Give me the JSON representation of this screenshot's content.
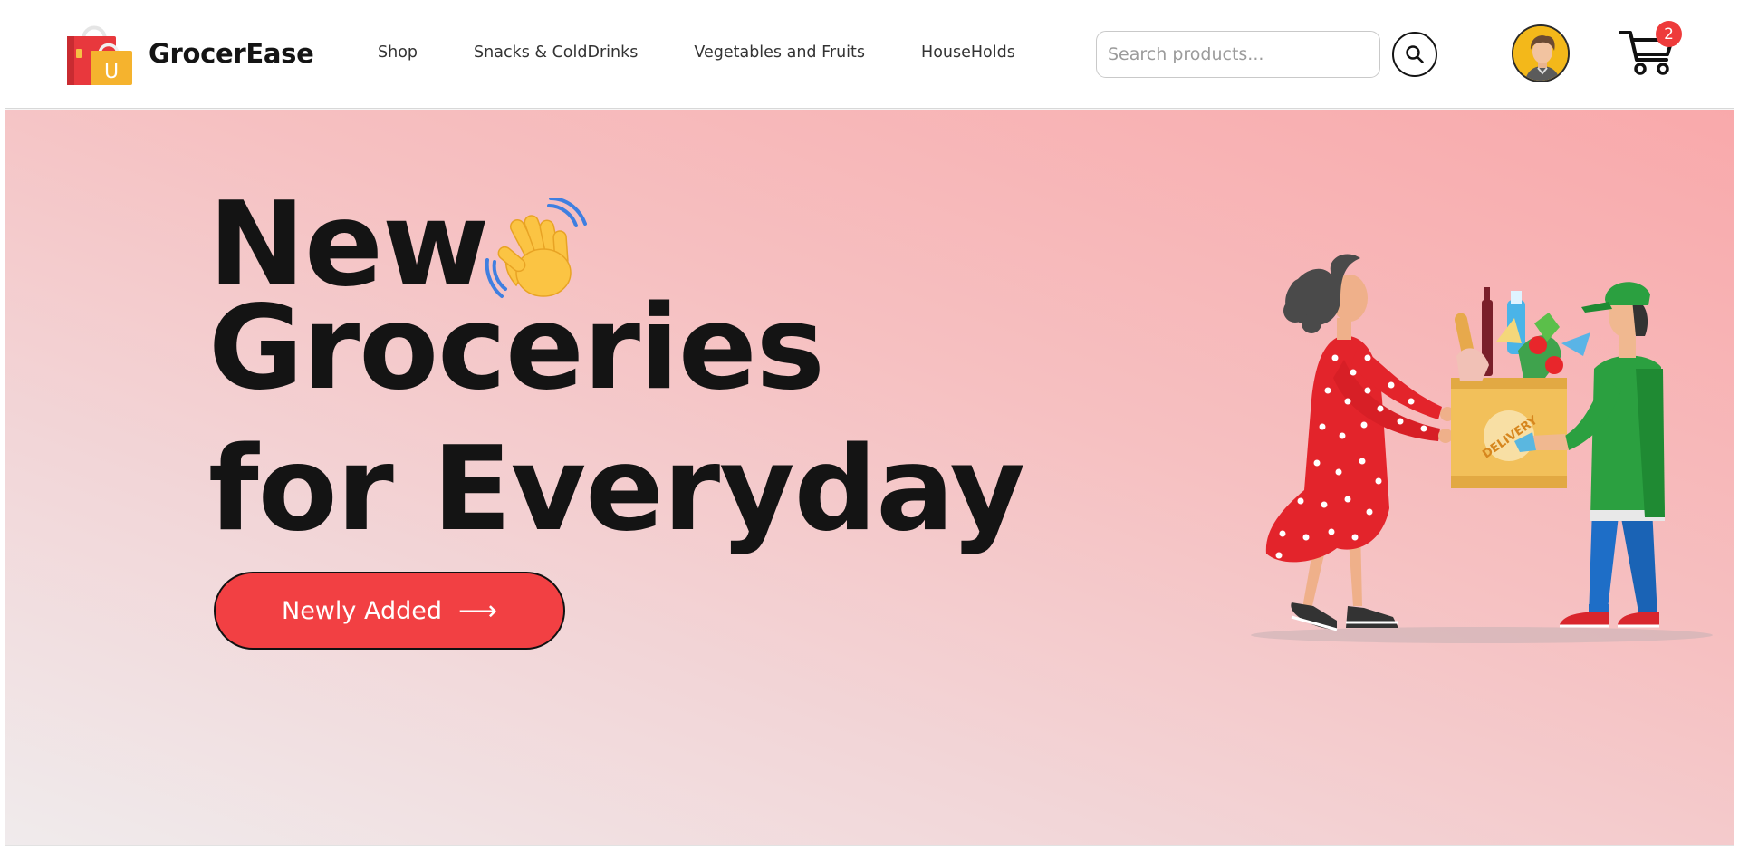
{
  "brand": {
    "name": "GrocerEase",
    "logo_letter": "U"
  },
  "nav": {
    "links": [
      {
        "label": "Shop"
      },
      {
        "label": "Snacks & ColdDrinks"
      },
      {
        "label": "Vegetables and Fruits"
      },
      {
        "label": "HouseHolds"
      }
    ]
  },
  "search": {
    "placeholder": "Search products...",
    "value": "",
    "icon": "search-icon"
  },
  "user": {
    "avatar_icon": "user-avatar"
  },
  "cart": {
    "icon": "cart-icon",
    "count": "2"
  },
  "hero": {
    "line1": "New",
    "line2": "Groceries",
    "line3": "for Everyday",
    "emoji_icon": "waving-hand-icon",
    "cta_label": "Newly Added",
    "cta_icon": "arrow-right-icon",
    "illustration": "grocery-delivery-illustration",
    "bag_text": "DELIVERY"
  },
  "colors": {
    "accent": "#f24043",
    "badge": "#ee3b3b",
    "hero_gradient_start": "#f9a9ab",
    "hero_gradient_end": "#f0ebec"
  }
}
